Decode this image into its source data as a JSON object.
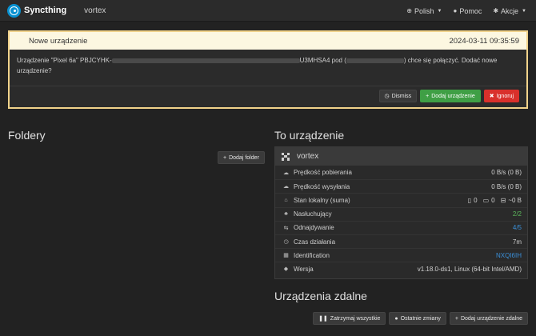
{
  "navbar": {
    "brand": "Syncthing",
    "device_name": "vortex",
    "language": "Polish",
    "help": "Pomoc",
    "actions": "Akcje"
  },
  "notice": {
    "title": "Nowe urządzenie",
    "timestamp": "2024-03-11 09:35:59",
    "message_part1": "Urządzenie \"Pixel 6a\" PBJCYHK-",
    "message_part2": "U3MHSA4 pod (",
    "message_part3": ") chce się połączyć. Dodać nowe urządzenie?",
    "dismiss": "Dismiss",
    "add_device": "Dodaj urządzenie",
    "ignore": "Ignoruj"
  },
  "folders": {
    "heading": "Foldery",
    "add_folder": "Dodaj folder"
  },
  "this_device": {
    "heading": "To urządzenie",
    "name": "vortex",
    "rows": [
      {
        "icon": "cloud-download-icon",
        "glyph": "☁",
        "label": "Prędkość pobierania",
        "value": "0 B/s (0 B)"
      },
      {
        "icon": "cloud-upload-icon",
        "glyph": "☁",
        "label": "Prędkość wysyłania",
        "value": "0 B/s (0 B)"
      },
      {
        "icon": "home-icon",
        "glyph": "⌂",
        "label": "Stan lokalny (suma)",
        "files": "0",
        "dirs": "0",
        "size": "~0 B"
      },
      {
        "icon": "sitemap-icon",
        "glyph": "♣",
        "label": "Nasłuchujący",
        "value": "2/2"
      },
      {
        "icon": "signpost-icon",
        "glyph": "⇆",
        "label": "Odnajdywanie",
        "value": "4/5"
      },
      {
        "icon": "clock-icon",
        "glyph": "◷",
        "label": "Czas działania",
        "value": "7m"
      },
      {
        "icon": "qrcode-icon",
        "glyph": "▦",
        "label": "Identification",
        "value": "NXQI6IH"
      },
      {
        "icon": "tag-icon",
        "glyph": "◆",
        "label": "Wersja",
        "value": "v1.18.0-ds1, Linux (64-bit Intel/AMD)"
      }
    ]
  },
  "remote": {
    "heading": "Urządzenia zdalne",
    "pause_all": "Zatrzymaj wszystkie",
    "recent_changes": "Ostatnie zmiany",
    "add_remote": "Dodaj urządzenie zdalne"
  },
  "colors": {
    "accent": "#0891d1",
    "success": "#3f9f45",
    "danger": "#d9302b",
    "warning_border": "#f1d38b"
  }
}
